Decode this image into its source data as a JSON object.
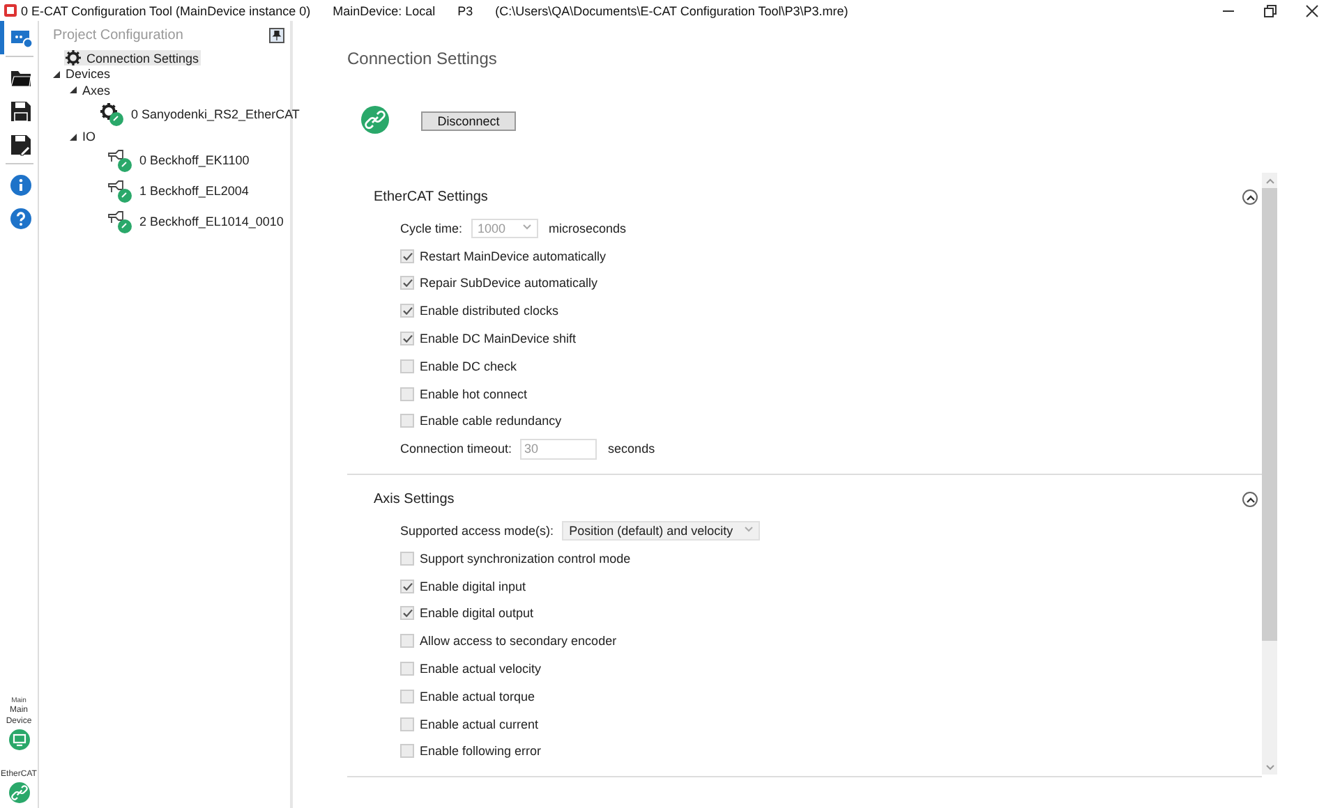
{
  "window": {
    "title": "0 E-CAT Configuration Tool (MainDevice instance 0)",
    "main_device": "MainDevice: Local",
    "project": "P3",
    "path": "(C:\\Users\\QA\\Documents\\E-CAT Configuration Tool\\P3\\P3.mre)"
  },
  "rail": {
    "items": [
      {
        "kind": "config",
        "selected": true
      },
      {
        "kind": "open",
        "selected": false
      },
      {
        "kind": "save",
        "selected": false
      },
      {
        "kind": "saveas",
        "selected": false
      },
      {
        "kind": "info",
        "selected": false
      },
      {
        "kind": "help",
        "selected": false
      }
    ],
    "bottom": [
      {
        "caption": "Main",
        "label": "Main Device",
        "kind": "monitor"
      },
      {
        "label": "EtherCAT",
        "kind": "link"
      }
    ]
  },
  "tree_panel": {
    "title": "Project Configuration",
    "items": [
      {
        "label": "Connection Settings",
        "kind": "gear",
        "selected": true
      },
      {
        "label": "Devices",
        "expanded": true,
        "children": [
          {
            "label": "Axes",
            "expanded": true,
            "children": [
              {
                "index": "0",
                "label": "Sanyodenki_RS2_EtherCAT",
                "kind": "axis"
              }
            ]
          },
          {
            "label": "IO",
            "expanded": true,
            "children": [
              {
                "index": "0",
                "label": "Beckhoff_EK1100",
                "kind": "io"
              },
              {
                "index": "1",
                "label": "Beckhoff_EL2004",
                "kind": "io"
              },
              {
                "index": "2",
                "label": "Beckhoff_EL1014_0010",
                "kind": "io"
              }
            ]
          }
        ]
      }
    ]
  },
  "content": {
    "title": "Connection Settings",
    "connected": true,
    "button": "Disconnect",
    "sections": [
      {
        "title": "EtherCAT Settings",
        "expanded": true,
        "rows": [
          {
            "kind": "dropdown",
            "label": "Cycle time:",
            "value": "1000",
            "unit": "microseconds",
            "disabled": true
          },
          {
            "kind": "checkbox",
            "label": "Restart MainDevice automatically",
            "checked": true
          },
          {
            "kind": "checkbox",
            "label": "Repair SubDevice automatically",
            "checked": true
          },
          {
            "kind": "checkbox",
            "label": "Enable distributed clocks",
            "checked": true
          },
          {
            "kind": "checkbox",
            "label": "Enable DC MainDevice shift",
            "checked": true
          },
          {
            "kind": "checkbox",
            "label": "Enable DC check",
            "checked": false
          },
          {
            "kind": "checkbox",
            "label": "Enable hot connect",
            "checked": false
          },
          {
            "kind": "checkbox",
            "label": "Enable cable redundancy",
            "checked": false
          },
          {
            "kind": "input",
            "label": "Connection timeout:",
            "value": "30",
            "unit": "seconds",
            "disabled": true
          }
        ]
      },
      {
        "title": "Axis Settings",
        "expanded": true,
        "rows": [
          {
            "kind": "dropdown",
            "label": "Supported access mode(s):",
            "value": "Position (default) and velocity",
            "disabled": false
          },
          {
            "kind": "checkbox",
            "label": "Support synchronization control mode",
            "checked": false
          },
          {
            "kind": "checkbox",
            "label": "Enable digital input",
            "checked": true
          },
          {
            "kind": "checkbox",
            "label": "Enable digital output",
            "checked": true
          },
          {
            "kind": "checkbox",
            "label": "Allow access to secondary encoder",
            "checked": false
          },
          {
            "kind": "checkbox",
            "label": "Enable actual velocity",
            "checked": false
          },
          {
            "kind": "checkbox",
            "label": "Enable actual torque",
            "checked": false
          },
          {
            "kind": "checkbox",
            "label": "Enable actual current",
            "checked": false
          },
          {
            "kind": "checkbox",
            "label": "Enable following error",
            "checked": false
          }
        ]
      }
    ]
  }
}
